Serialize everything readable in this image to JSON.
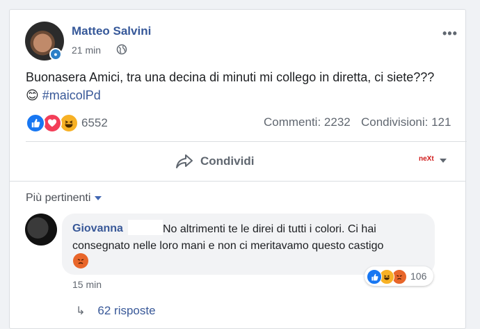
{
  "post": {
    "author": "Matteo Salvini",
    "time": "21 min",
    "text": "Buonasera Amici, tra una decina di minuti mi collego in diretta, ci siete??? ",
    "emoji": "😊",
    "hashtag": "#maicolPd",
    "reaction_count": "6552",
    "comments_label": "Commenti: 2232",
    "shares_label": "Condivisioni: 121",
    "share_button_label": "Condividi",
    "page_logo_text": "neXt"
  },
  "icons": {
    "reaction_like": "like-icon",
    "reaction_love": "love-icon",
    "reaction_haha": "haha-icon",
    "globe": "globe-icon",
    "share": "share-arrow-icon",
    "more": "more-options-icon"
  },
  "comments_section": {
    "filter_label": "Più pertinenti",
    "comment": {
      "author": "Giovanna",
      "text": "No altrimenti te le direi di tutti i colori. Ci hai consegnato nelle loro mani e non ci meritavamo questo castigo",
      "reaction_count": "106",
      "time": "15 min",
      "replies_label": "62 risposte"
    }
  },
  "colors": {
    "link_blue": "#385898",
    "like_blue": "#1877f2",
    "love_red": "#f33e58",
    "haha_yellow": "#f7b125",
    "angry_orange": "#e8662a"
  }
}
